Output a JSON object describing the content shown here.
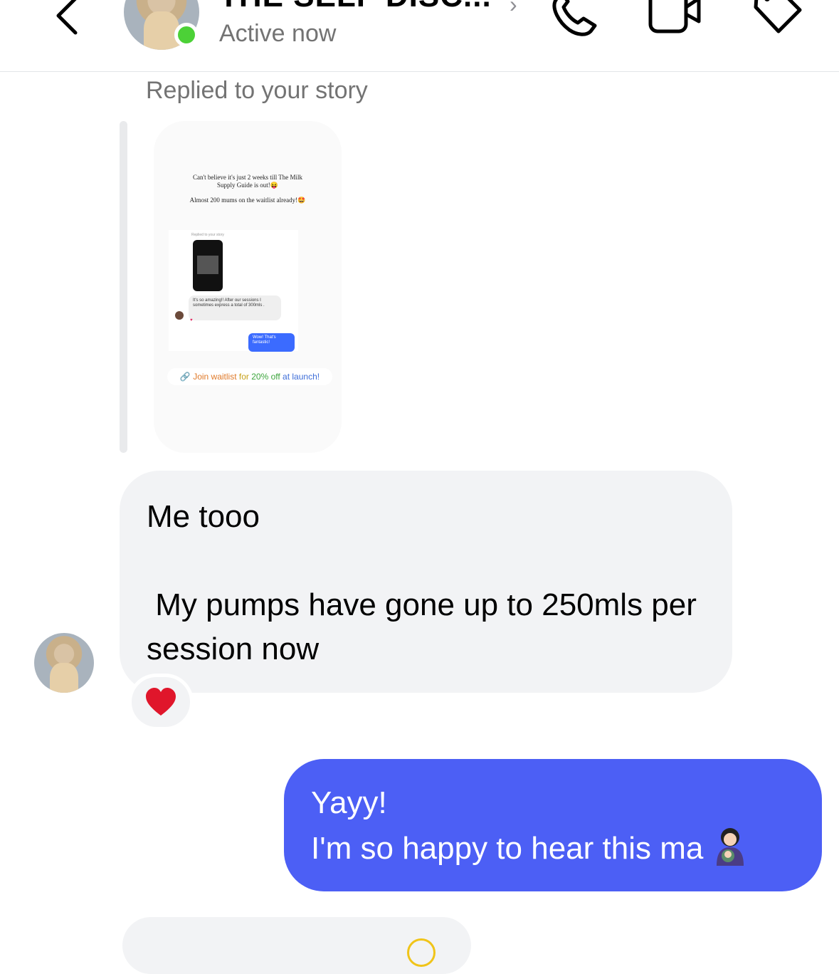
{
  "header": {
    "title": "THE SELF DISC...",
    "title_chevron": "›",
    "status": "Active now",
    "icons": [
      "back-chevron-icon",
      "phone-icon",
      "video-icon",
      "tag-icon"
    ]
  },
  "thread": {
    "replied_label": "Replied to your story",
    "story": {
      "text_line1": "Can't believe it's just 2 weeks till The Milk",
      "text_line2": "Supply Guide is out!😝",
      "text_line3": "Almost 200 mums on the waitlist already!🤩",
      "mini_replied": "Replied to your story",
      "mini_message": "It's so amazing!! After our sessions I sometimes express a total of 300mls .",
      "mini_reply": "Wow! That's fantastic!",
      "link_parts": [
        "Join waitlist ",
        "for ",
        "20% off ",
        "at launch!"
      ]
    },
    "incoming_message": "Me tooo\n\n My pumps have gone up to 250mls per session now",
    "reaction": "❤️",
    "outgoing_message": "Yayy!\nI'm so happy to hear this ma"
  },
  "colors": {
    "outgoing_bubble": "#4c5ff5",
    "incoming_bubble": "#f2f3f5",
    "online": "#4cd137"
  }
}
